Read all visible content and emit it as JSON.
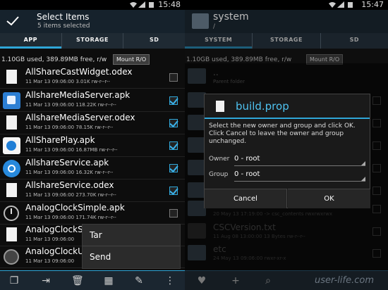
{
  "status_left": {
    "time": "15:48"
  },
  "status_right": {
    "time": "15:47"
  },
  "left": {
    "header": {
      "title": "Select Items",
      "subtitle": "5 items selected"
    },
    "tabs": [
      "APP",
      "STORAGE",
      "SD"
    ],
    "active_tab": "APP",
    "info": "1.10GB used, 389.89MB free, r/w",
    "mount_label": "Mount R/O",
    "files": [
      {
        "name": "AllShareCastWidget.odex",
        "meta": "11 Mar 13 09:06:00   3.01K  rw-r--r--",
        "checked": false,
        "icon": "document-icon"
      },
      {
        "name": "AllshareMediaServer.apk",
        "meta": "11 Mar 13 09:06:00   118.22K  rw-r--r--",
        "checked": true,
        "icon": "media-server-app-icon"
      },
      {
        "name": "AllshareMediaServer.odex",
        "meta": "11 Mar 13 09:06:00   78.15K  rw-r--r--",
        "checked": true,
        "icon": "document-icon"
      },
      {
        "name": "AllSharePlay.apk",
        "meta": "11 Mar 13 09:06:00   16.87MB  rw-r--r--",
        "checked": true,
        "icon": "allshare-play-app-icon"
      },
      {
        "name": "AllshareService.apk",
        "meta": "11 Mar 13 09:06:00   16.32K  rw-r--r--",
        "checked": true,
        "icon": "allshare-service-app-icon"
      },
      {
        "name": "AllshareService.odex",
        "meta": "11 Mar 13 09:06:00   273.70K  rw-r--r--",
        "checked": true,
        "icon": "document-icon"
      },
      {
        "name": "AnalogClockSimple.apk",
        "meta": "11 Mar 13 09:06:00   171.74K  rw-r--r--",
        "checked": false,
        "icon": "analog-clock-app-icon"
      },
      {
        "name": "AnalogClockS",
        "meta": "11 Mar 13 09:06:00",
        "checked": false,
        "icon": "document-icon"
      },
      {
        "name": "AnalogClockU",
        "meta": "11 Mar 13 09:06:00",
        "checked": false,
        "icon": "clock-app-icon"
      }
    ],
    "popup": [
      "Tar",
      "Send"
    ]
  },
  "right": {
    "header": {
      "title": "system",
      "path": "/"
    },
    "tabs": [
      "SYSTEM",
      "STORAGE",
      "SD"
    ],
    "active_tab": "SYSTEM",
    "info": "1.10GB used, 389.89MB free, r/w",
    "mount_label": "Mount R/O",
    "parent": {
      "name": "..",
      "meta": "Parent folder"
    },
    "dialog": {
      "title": "build.prop",
      "message": "Select the new owner and group and click OK. Click Cancel to leave the owner and group unchanged.",
      "owner_label": "Owner",
      "owner_value": "0 - root",
      "group_label": "Group",
      "group_value": "0 - root",
      "cancel": "Cancel",
      "ok": "OK"
    },
    "rows": [
      {
        "name": "",
        "meta": "20 May 13 17:19:00   -> csc_contents  rwxrwxrwx"
      },
      {
        "name": "CSCVersion.txt",
        "meta": "11 Aug 08 13:00:00   13 Bytes  rw-r--r--"
      },
      {
        "name": "etc",
        "meta": "24 May 13 09:06:00        rwxr-xr-x"
      }
    ],
    "watermark": "user-life.com"
  }
}
